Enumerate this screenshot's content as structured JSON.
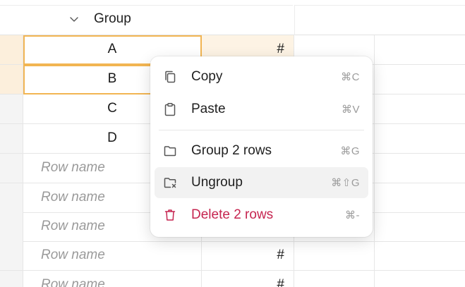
{
  "group": {
    "label": "Group"
  },
  "rows": [
    {
      "name": "A",
      "value": "#",
      "selected": true
    },
    {
      "name": "B",
      "value": "",
      "selected": true
    },
    {
      "name": "C",
      "value": "",
      "selected": false
    },
    {
      "name": "D",
      "value": "",
      "selected": false
    },
    {
      "name": "",
      "placeholder": "Row name",
      "value": ""
    },
    {
      "name": "",
      "placeholder": "Row name",
      "value": ""
    },
    {
      "name": "",
      "placeholder": "Row name",
      "value": ""
    },
    {
      "name": "",
      "placeholder": "Row name",
      "value": "#"
    },
    {
      "name": "",
      "placeholder": "Row name",
      "value": "#"
    }
  ],
  "context_menu": {
    "copy": {
      "label": "Copy",
      "shortcut": "⌘C",
      "icon": "copy-icon"
    },
    "paste": {
      "label": "Paste",
      "shortcut": "⌘V",
      "icon": "clipboard-icon"
    },
    "group": {
      "label": "Group 2 rows",
      "shortcut": "⌘G",
      "icon": "folder-icon"
    },
    "ungroup": {
      "label": "Ungroup",
      "shortcut": "⌘⇧G",
      "icon": "folder-remove-icon"
    },
    "delete": {
      "label": "Delete 2 rows",
      "shortcut": "⌘-",
      "icon": "trash-icon"
    }
  },
  "colors": {
    "selection_border": "#f2b552",
    "selection_fill": "#fdf3e4",
    "danger": "#c62550",
    "placeholder": "#9a9a9a"
  }
}
